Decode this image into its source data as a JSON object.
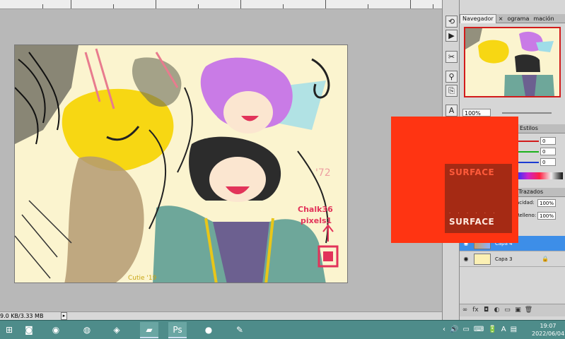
{
  "ruler": {
    "marks": [
      "",
      "",
      "",
      "",
      "",
      "",
      "",
      "",
      "",
      "",
      ""
    ]
  },
  "status": {
    "doc_size": "9.0 KB/3.33 MB",
    "arrow": "▸"
  },
  "panels": {
    "navigator_tabs": [
      {
        "label": "Navegador",
        "active": true
      },
      {
        "label": "×",
        "active": false
      },
      {
        "label": "ograma",
        "active": false
      },
      {
        "label": "mación",
        "active": false
      }
    ],
    "zoom_value": "100%",
    "color_tabs": [
      {
        "label": "Estilos"
      }
    ],
    "color_values": {
      "r": "0",
      "g": "0",
      "b": "0"
    },
    "layers_tab": "Trazados",
    "opacity_label": "acidad:",
    "opacity_value": "100%",
    "fill_label": "Relleno:",
    "fill_value": "100%",
    "layers": [
      {
        "name": "Capa 4",
        "selected": true
      },
      {
        "name": "Capa 3",
        "selected": false
      }
    ],
    "footer_icons": [
      "∞",
      "fx",
      "◘",
      "◐",
      "▭",
      "▣",
      "🗑"
    ]
  },
  "overlay": {
    "text_top": "SURFACE",
    "text_bottom": "SURFACE",
    "dots": "· · · · · ·"
  },
  "canvas_art": {
    "signature": "Chalk36\npixels1",
    "year_mark": "'72",
    "bottom_mark": "Cutie '19"
  },
  "taskbar": {
    "apps": [
      {
        "name": "windows-icon",
        "glyph": "⊞"
      },
      {
        "name": "dolby-icon",
        "glyph": "◙"
      },
      {
        "name": "chrome-icon",
        "glyph": "◉"
      },
      {
        "name": "edge-icon",
        "glyph": "◍"
      },
      {
        "name": "firefox-icon",
        "glyph": "◈"
      },
      {
        "name": "folder-icon",
        "glyph": "▰"
      },
      {
        "name": "photoshop-icon",
        "glyph": "Ps"
      },
      {
        "name": "colorball-icon",
        "glyph": "●"
      },
      {
        "name": "paint-icon",
        "glyph": "✎"
      }
    ],
    "tray": [
      "‹",
      "🔊",
      "▭",
      "⌨",
      "🔋",
      "A",
      "▤"
    ],
    "time": "19:07",
    "date": "2022/06/04"
  },
  "colors": {
    "overlay": "#ff3412",
    "overlay_inner": "#a52a14",
    "selection": "#3d8ee8",
    "taskbar": "#4e8c8a"
  }
}
